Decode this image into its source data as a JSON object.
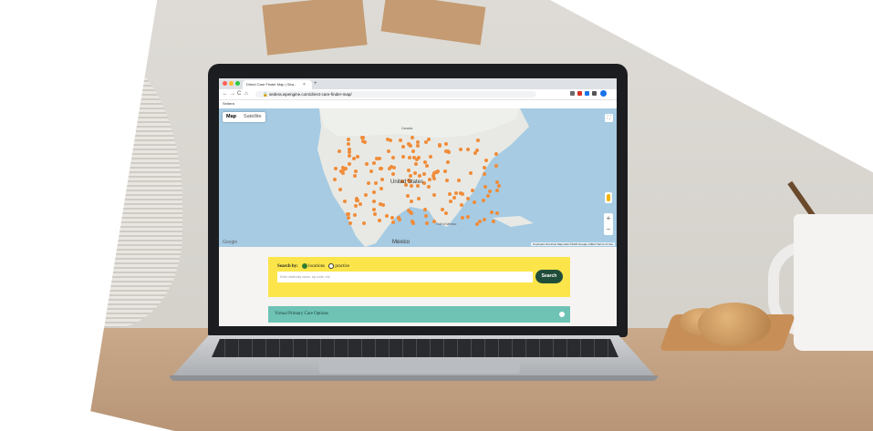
{
  "browser": {
    "tab_title": "Direct Care Finder Map | Sea...",
    "tab_close": "×",
    "new_tab": "+",
    "url_prefix": "🔒",
    "url": "sedera.wpengine.com/direct-care-finder-map/",
    "bookmark": "Sedera",
    "nav": {
      "back": "←",
      "forward": "→",
      "reload": "C",
      "home": "⌂"
    }
  },
  "map": {
    "toggle": {
      "map": "Map",
      "satellite": "Satellite"
    },
    "labels": {
      "canada": "Canada",
      "united_states": "United States",
      "mexico": "Mexico",
      "gulf": "Gulf of Mexico"
    },
    "zoom_in": "+",
    "zoom_out": "−",
    "fullscreen": "⛶",
    "google": "Google",
    "attribution": "Keyboard shortcuts   Map data ©2023 Google, INEGI   Terms of Use",
    "marker_color": "#f08c3a"
  },
  "search": {
    "label": "Search by:",
    "option_locations": "locations",
    "option_practice": "practice",
    "placeholder": "Enter state/city name, zip code, etc.",
    "button": "Search"
  },
  "virtual": {
    "label": "Virtual Primary Care Options"
  }
}
